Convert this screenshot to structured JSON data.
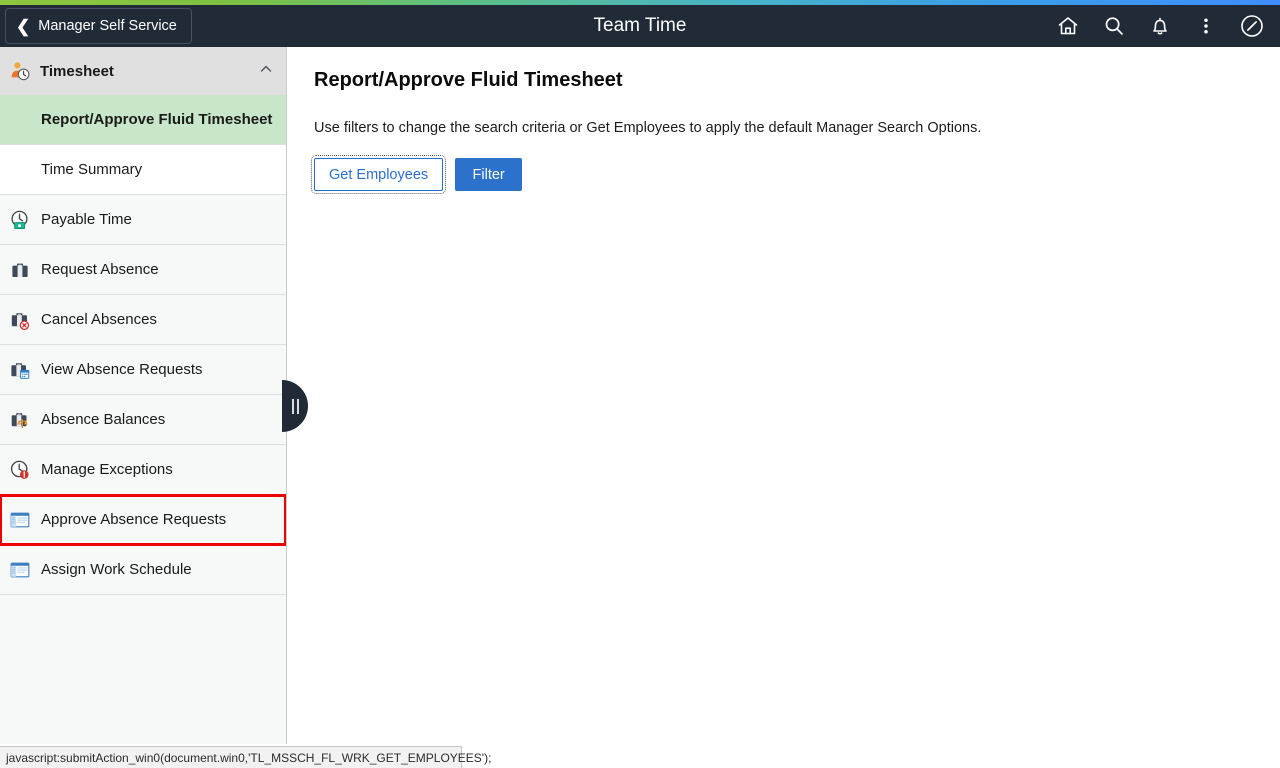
{
  "header": {
    "back_label": "Manager Self Service",
    "back_icon": "chevron-left-icon",
    "title": "Team Time",
    "actions": [
      {
        "icon": "home-icon",
        "label": "Home"
      },
      {
        "icon": "search-icon",
        "label": "Search"
      },
      {
        "icon": "bell-icon",
        "label": "Notifications"
      },
      {
        "icon": "kebab-menu-icon",
        "label": "Actions"
      },
      {
        "icon": "navbar-compass-icon",
        "label": "NavBar"
      }
    ]
  },
  "sidebar": {
    "group": {
      "label": "Timesheet",
      "icon": "person-clock-icon",
      "expanded": true,
      "caret_icon": "chevron-up-icon"
    },
    "items": [
      {
        "label": "Report/Approve Fluid Timesheet",
        "icon": "none",
        "state": "selected",
        "sub": true
      },
      {
        "label": "Time Summary",
        "icon": "none",
        "state": "plain",
        "sub": true
      },
      {
        "label": "Payable Time",
        "icon": "clock-money-icon",
        "state": "normal",
        "sub": false
      },
      {
        "label": "Request Absence",
        "icon": "briefcase-icon",
        "state": "normal",
        "sub": false
      },
      {
        "label": "Cancel Absences",
        "icon": "briefcase-cancel-icon",
        "state": "normal",
        "sub": false
      },
      {
        "label": "View Absence Requests",
        "icon": "briefcase-calendar-icon",
        "state": "normal",
        "sub": false
      },
      {
        "label": "Absence Balances",
        "icon": "briefcase-balance-icon",
        "state": "normal",
        "sub": false
      },
      {
        "label": "Manage Exceptions",
        "icon": "clock-alert-icon",
        "state": "normal",
        "sub": false
      },
      {
        "label": "Approve Absence Requests",
        "icon": "window-page-icon",
        "state": "highlighted",
        "sub": false
      },
      {
        "label": "Assign Work Schedule",
        "icon": "window-page-icon",
        "state": "normal",
        "sub": false
      }
    ],
    "collapse_handle_icon": "pause-bars-icon"
  },
  "main": {
    "page_title": "Report/Approve Fluid Timesheet",
    "instruction": "Use filters to change the search criteria or Get Employees to apply the default Manager Search Options.",
    "get_employees_label": "Get Employees",
    "filter_label": "Filter"
  },
  "status_bar": {
    "text": "javascript:submitAction_win0(document.win0,'TL_MSSCH_FL_WRK_GET_EMPLOYEES');"
  },
  "colors": {
    "header_bg": "#212b38",
    "selected_item_bg": "#c8e6c9",
    "highlight_outline": "#ee0000",
    "primary_button_bg": "#2c72cd",
    "link_blue": "#2c6fd4"
  }
}
